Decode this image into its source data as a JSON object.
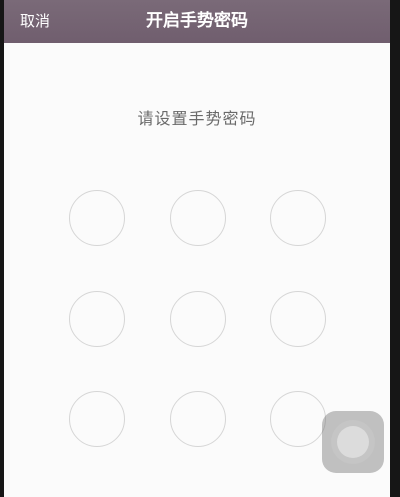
{
  "navbar": {
    "cancel_label": "取消",
    "title": "开启手势密码",
    "background_color": "#745f71"
  },
  "main": {
    "prompt": "请设置手势密码"
  },
  "gesture_grid": {
    "rows": 3,
    "columns": 3,
    "dot_border_color": "#d6d6d6"
  },
  "assistive_touch": {
    "icon": "assistive-touch-icon"
  }
}
